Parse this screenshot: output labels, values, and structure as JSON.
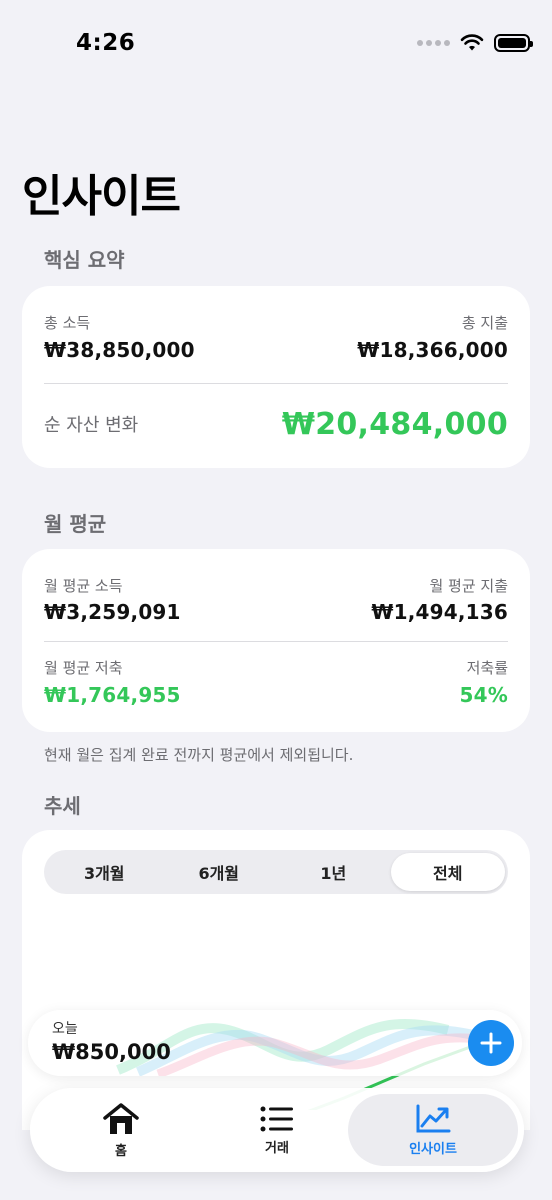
{
  "status": {
    "time": "4:26"
  },
  "page": {
    "title": "인사이트"
  },
  "summary": {
    "section_title": "핵심 요약",
    "total_income_label": "총 소득",
    "total_income_value": "₩38,850,000",
    "total_expense_label": "총 지출",
    "total_expense_value": "₩18,366,000",
    "net_change_label": "순 자산 변화",
    "net_change_value": "₩20,484,000"
  },
  "monthly": {
    "section_title": "월 평균",
    "avg_income_label": "월 평균 소득",
    "avg_income_value": "₩3,259,091",
    "avg_expense_label": "월 평균 지출",
    "avg_expense_value": "₩1,494,136",
    "avg_saving_label": "월 평균 저축",
    "avg_saving_value": "₩1,764,955",
    "saving_rate_label": "저축률",
    "saving_rate_value": "54%",
    "note": "현재 월은 집계 완료 전까지 평균에서 제외됩니다."
  },
  "trend": {
    "section_title": "추세",
    "segments": [
      "3개월",
      "6개월",
      "1년",
      "전체"
    ],
    "selected_segment": "전체"
  },
  "today": {
    "label": "오늘",
    "value": "₩850,000"
  },
  "tabs": [
    {
      "label": "홈",
      "icon": "house-icon",
      "active": false
    },
    {
      "label": "거래",
      "icon": "list-icon",
      "active": false
    },
    {
      "label": "인사이트",
      "icon": "chart-trend-icon",
      "active": true
    }
  ],
  "colors": {
    "accent": "#1a7ff0",
    "positive": "#34c759",
    "background": "#f2f2f7"
  }
}
